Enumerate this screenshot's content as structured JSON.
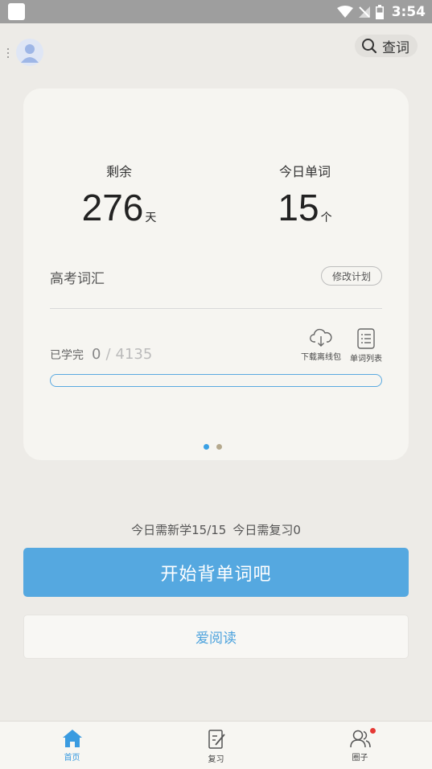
{
  "status_bar": {
    "time": "3:54"
  },
  "header": {
    "search_label": "查词"
  },
  "plan": {
    "remaining_label": "剩余",
    "remaining_value": "276",
    "remaining_unit": "天",
    "today_words_label": "今日单词",
    "today_words_value": "15",
    "today_words_unit": "个",
    "vocab_name": "高考词汇",
    "edit_plan_label": "修改计划",
    "learned_label": "已学完",
    "learned_count": "0",
    "learned_separator": "/",
    "total_count": "4135",
    "progress_fraction": 0,
    "download_label": "下载离线包",
    "wordlist_label": "单词列表",
    "page_count": 2,
    "active_page": 1
  },
  "daily": {
    "new_label": "今日需新学15/15",
    "review_label": "今日需复习0"
  },
  "start_button": "开始背单词吧",
  "read_button": "爱阅读",
  "tabs": [
    {
      "label": "首页",
      "icon": "home-icon",
      "active": true
    },
    {
      "label": "复习",
      "icon": "review-icon",
      "active": false
    },
    {
      "label": "圈子",
      "icon": "community-icon",
      "active": false,
      "badge": true
    }
  ],
  "colors": {
    "accent": "#55a8e0",
    "background": "#edebe7",
    "badge": "#e53935"
  }
}
